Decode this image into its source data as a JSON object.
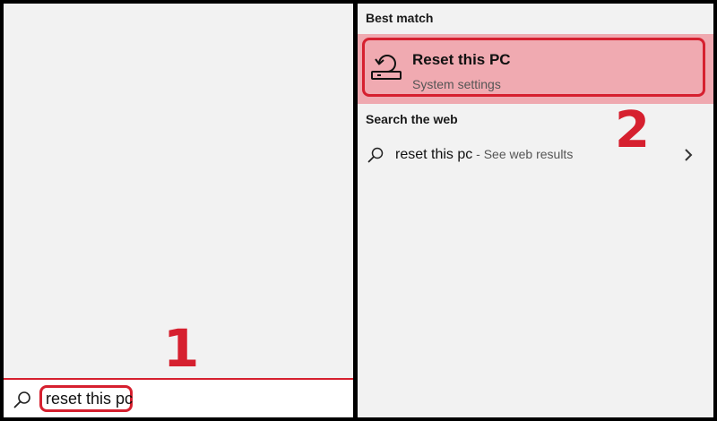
{
  "search_bar": {
    "query": "reset this pc",
    "icon": "search-icon"
  },
  "step_markers": {
    "first": "1",
    "second": "2"
  },
  "results": {
    "best_match_label": "Best match",
    "best_match": {
      "title": "Reset this PC",
      "subtitle": "System settings",
      "icon": "reset-pc-icon"
    },
    "web_label": "Search the web",
    "web_result": {
      "query": "reset this pc",
      "suffix": " - See web results",
      "icon": "search-icon",
      "chevron": "chevron-right-icon"
    }
  },
  "colors": {
    "highlight_red": "#d6202f",
    "selection_pink": "#efa9b0",
    "panel_bg": "#f2f2f2"
  }
}
